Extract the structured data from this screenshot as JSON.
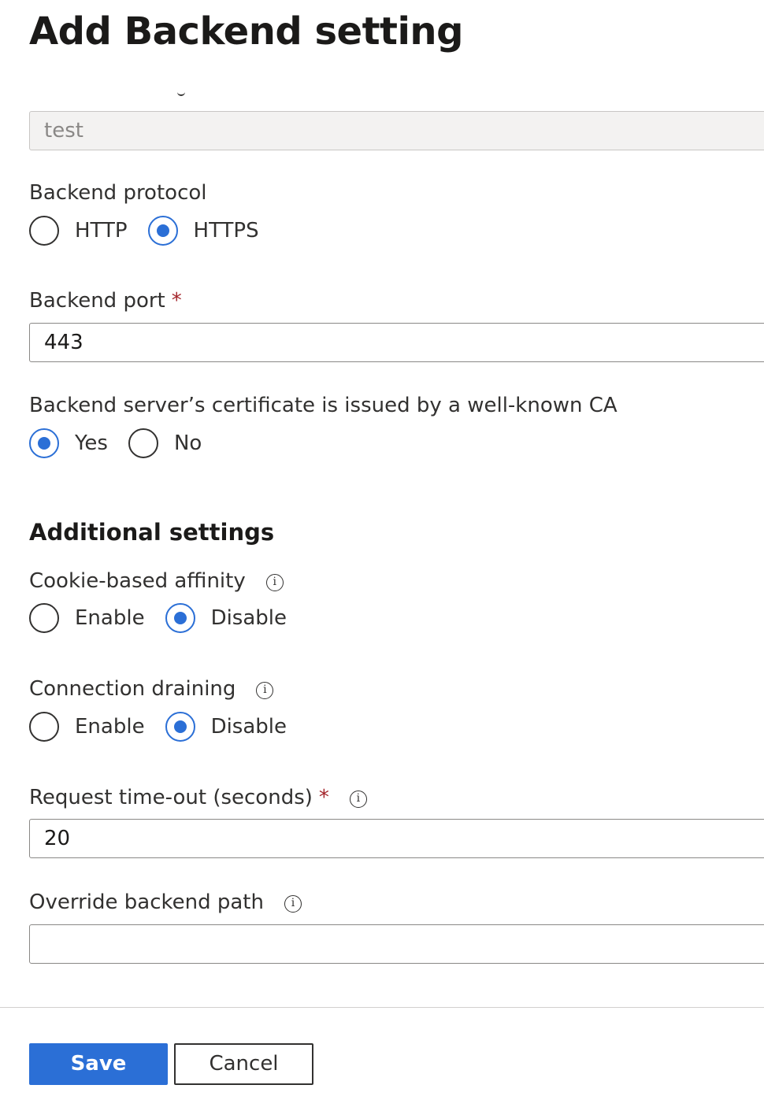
{
  "title": "Add Backend setting",
  "name_field": {
    "value": "test"
  },
  "backend_protocol": {
    "label": "Backend protocol",
    "options": [
      "HTTP",
      "HTTPS"
    ],
    "selected": "HTTPS"
  },
  "backend_port": {
    "label": "Backend port",
    "required_marker": "*",
    "value": "443"
  },
  "well_known_ca": {
    "label": "Backend server’s certificate is issued by a well-known CA",
    "options": [
      "Yes",
      "No"
    ],
    "selected": "Yes"
  },
  "additional_settings": {
    "heading": "Additional settings",
    "cookie_affinity": {
      "label": "Cookie-based affinity",
      "info": "i",
      "options": [
        "Enable",
        "Disable"
      ],
      "selected": "Disable"
    },
    "connection_draining": {
      "label": "Connection draining",
      "info": "i",
      "options": [
        "Enable",
        "Disable"
      ],
      "selected": "Disable"
    },
    "request_timeout": {
      "label": "Request time-out (seconds)",
      "required_marker": "*",
      "info": "i",
      "value": "20"
    },
    "override_path": {
      "label": "Override backend path",
      "info": "i",
      "value": ""
    }
  },
  "footer": {
    "save_label": "Save",
    "cancel_label": "Cancel"
  },
  "colors": {
    "accent": "#2b6fd6",
    "required": "#a4262c",
    "text": "#323130"
  }
}
